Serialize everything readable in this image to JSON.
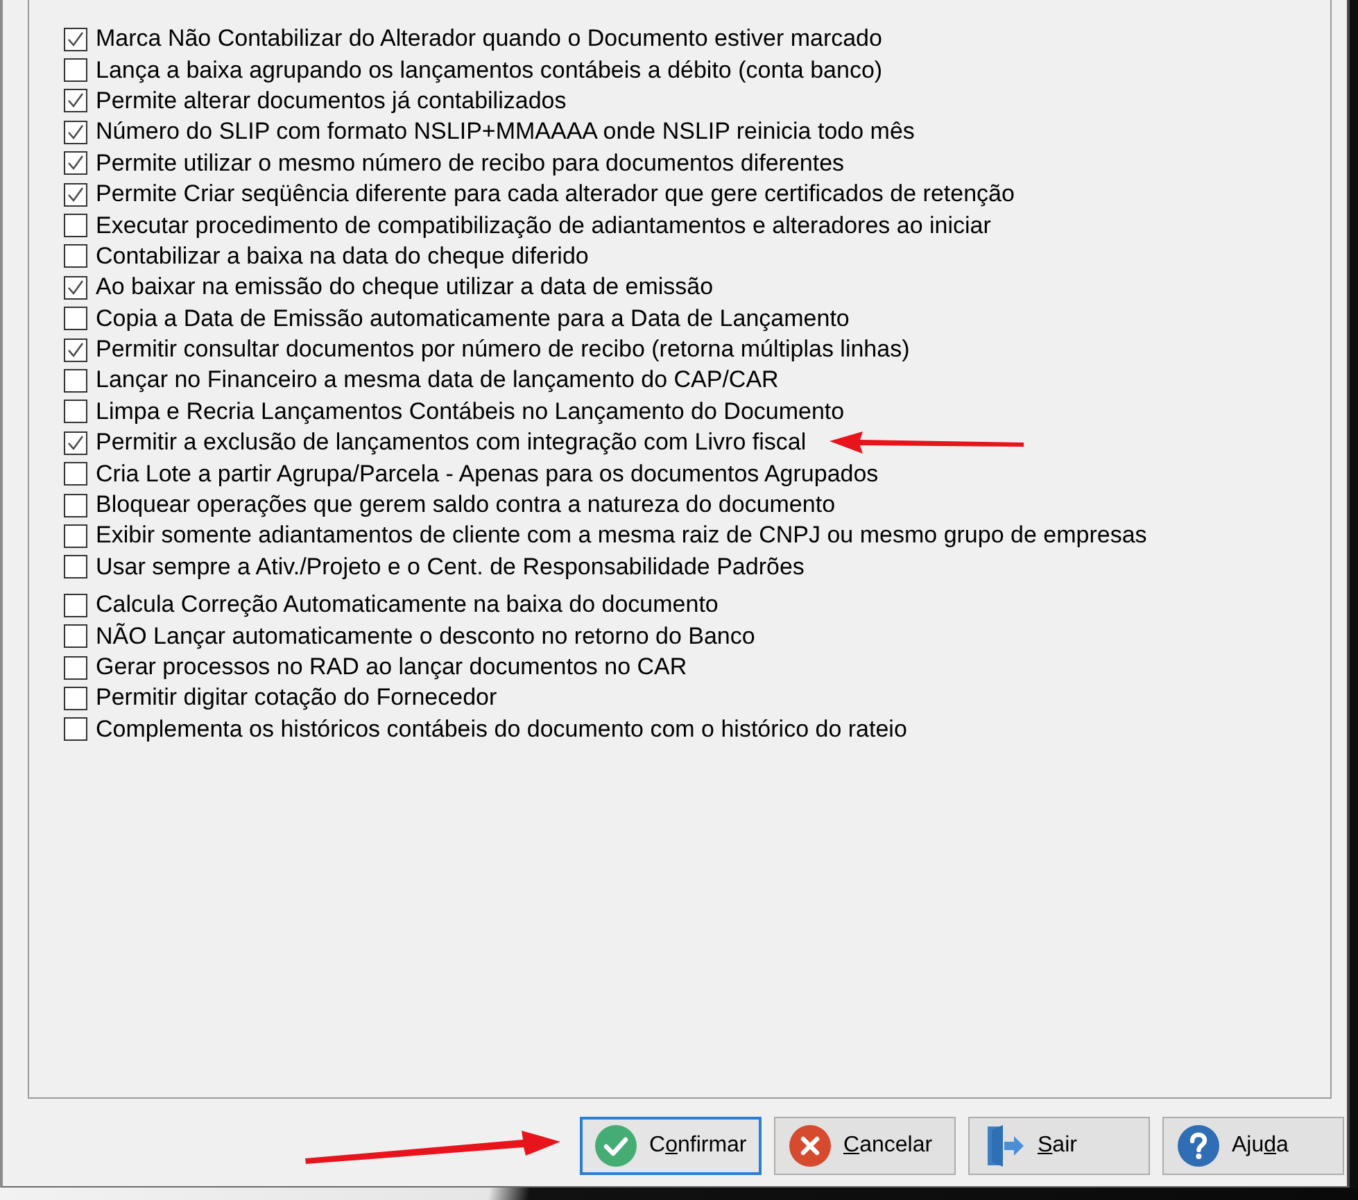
{
  "option_groups": [
    {
      "options": [
        {
          "label": "Marca Não Contabilizar do Alterador quando o Documento estiver marcado",
          "checked": true
        },
        {
          "label": "Lança a baixa agrupando os lançamentos contábeis a débito (conta banco)",
          "checked": false
        },
        {
          "label": "Permite alterar documentos já contabilizados",
          "checked": true
        },
        {
          "label": "Número do SLIP com formato NSLIP+MMAAAA onde NSLIP reinicia todo mês",
          "checked": true
        },
        {
          "label": "Permite utilizar o mesmo número de recibo para documentos diferentes",
          "checked": true
        },
        {
          "label": "Permite Criar seqüência diferente para cada alterador que gere certificados de retenção",
          "checked": true
        },
        {
          "label": "Executar procedimento de compatibilização de adiantamentos e alteradores ao iniciar",
          "checked": false
        },
        {
          "label": "Contabilizar a baixa na data do cheque diferido",
          "checked": false
        },
        {
          "label": "Ao baixar na emissão do cheque utilizar a data de emissão",
          "checked": true
        },
        {
          "label": "Copia a Data de Emissão automaticamente para a Data de Lançamento",
          "checked": false
        },
        {
          "label": "Permitir consultar documentos por número de recibo (retorna múltiplas linhas)",
          "checked": true
        },
        {
          "label": "Lançar no Financeiro a mesma data de lançamento do CAP/CAR",
          "checked": false
        },
        {
          "label": "Limpa e Recria Lançamentos Contábeis no Lançamento do Documento",
          "checked": false
        },
        {
          "label": "Permitir a exclusão de lançamentos com integração com Livro fiscal",
          "checked": true
        },
        {
          "label": "Cria Lote a partir Agrupa/Parcela - Apenas para os documentos Agrupados",
          "checked": false
        },
        {
          "label": "Bloquear operações que gerem saldo contra a natureza do documento",
          "checked": false
        },
        {
          "label": "Exibir somente adiantamentos de cliente com a mesma raiz de CNPJ ou mesmo grupo de empresas",
          "checked": false
        },
        {
          "label": "Usar sempre a Ativ./Projeto e o Cent. de Responsabilidade Padrões",
          "checked": false
        }
      ]
    },
    {
      "options": [
        {
          "label": "Calcula Correção Automaticamente na baixa do documento",
          "checked": false
        },
        {
          "label": "NÃO Lançar automaticamente o desconto no retorno do Banco",
          "checked": false
        },
        {
          "label": "Gerar processos no RAD ao lançar documentos no CAR",
          "checked": false
        },
        {
          "label": "Permitir digitar cotação do Fornecedor",
          "checked": false
        },
        {
          "label": "Complementa os históricos contábeis do documento com o histórico do rateio",
          "checked": false
        }
      ]
    }
  ],
  "buttons": [
    {
      "kind": "confirm",
      "label_before": "C",
      "mnemonic": "o",
      "label_after": "nfirmar",
      "focused": true
    },
    {
      "kind": "cancel",
      "mnemonic": "C",
      "label_after": "ancelar",
      "focused": false
    },
    {
      "kind": "exit",
      "mnemonic": "S",
      "label_after": "air",
      "focused": false
    },
    {
      "kind": "help",
      "label_before": "Aju",
      "mnemonic": "d",
      "label_after": "a",
      "focused": false
    }
  ]
}
